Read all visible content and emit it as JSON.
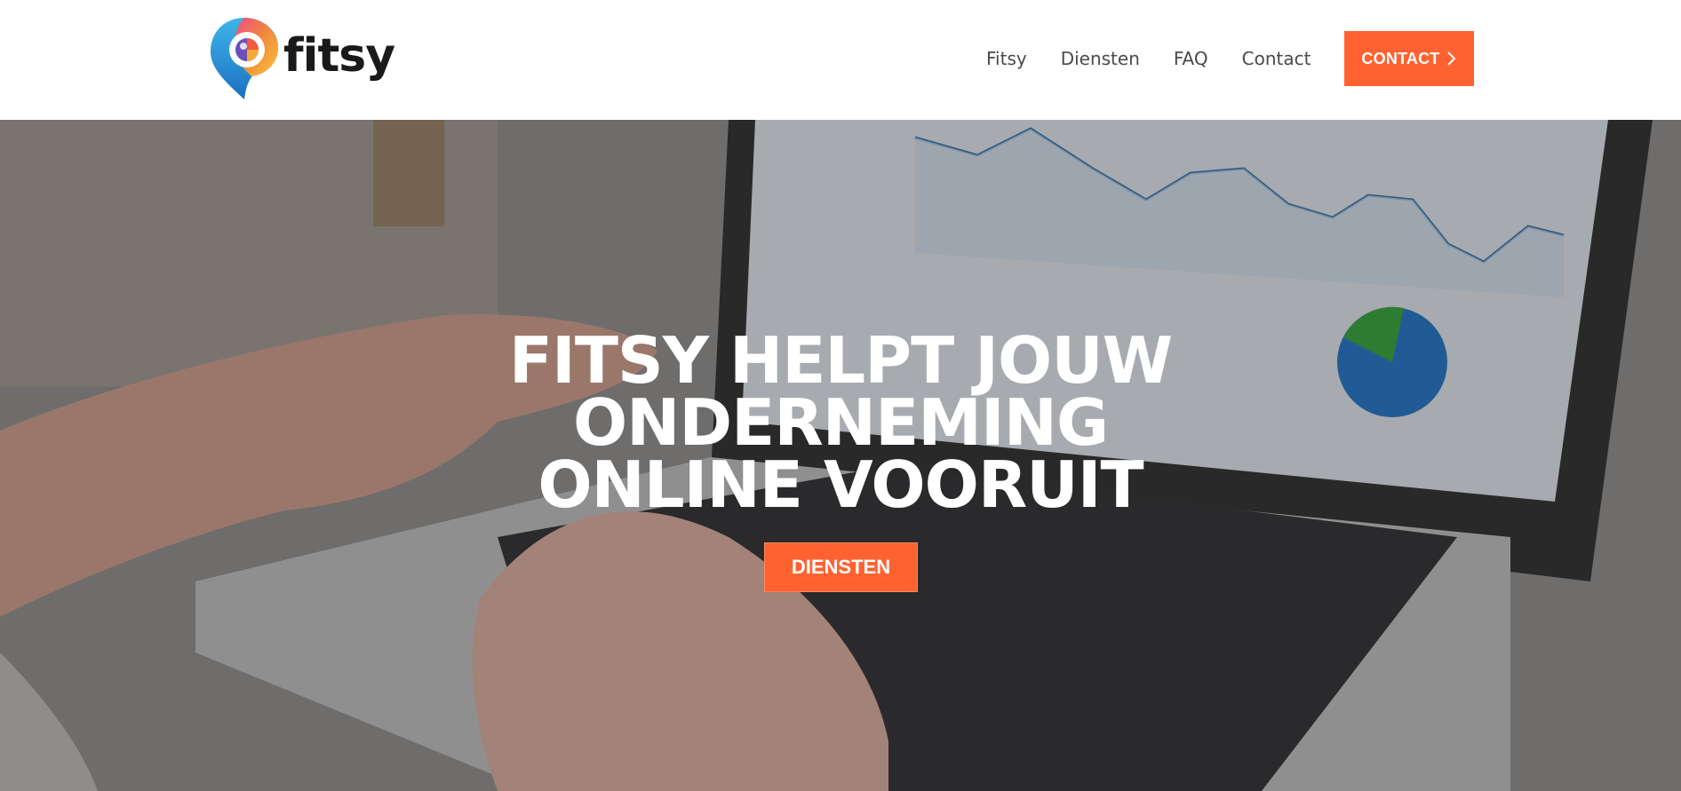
{
  "brand": {
    "name": "fitsy",
    "accent": "#ff6231"
  },
  "nav": {
    "items": [
      {
        "label": "Fitsy"
      },
      {
        "label": "Diensten"
      },
      {
        "label": "FAQ"
      },
      {
        "label": "Contact"
      }
    ],
    "cta_label": "CONTACT",
    "cta_icon": "chevron-right-icon"
  },
  "hero": {
    "title_lines": [
      "FITSY HELPT JOUW",
      "ONDERNEMING",
      "ONLINE VOORUIT"
    ],
    "button_label": "DIENSTEN"
  }
}
